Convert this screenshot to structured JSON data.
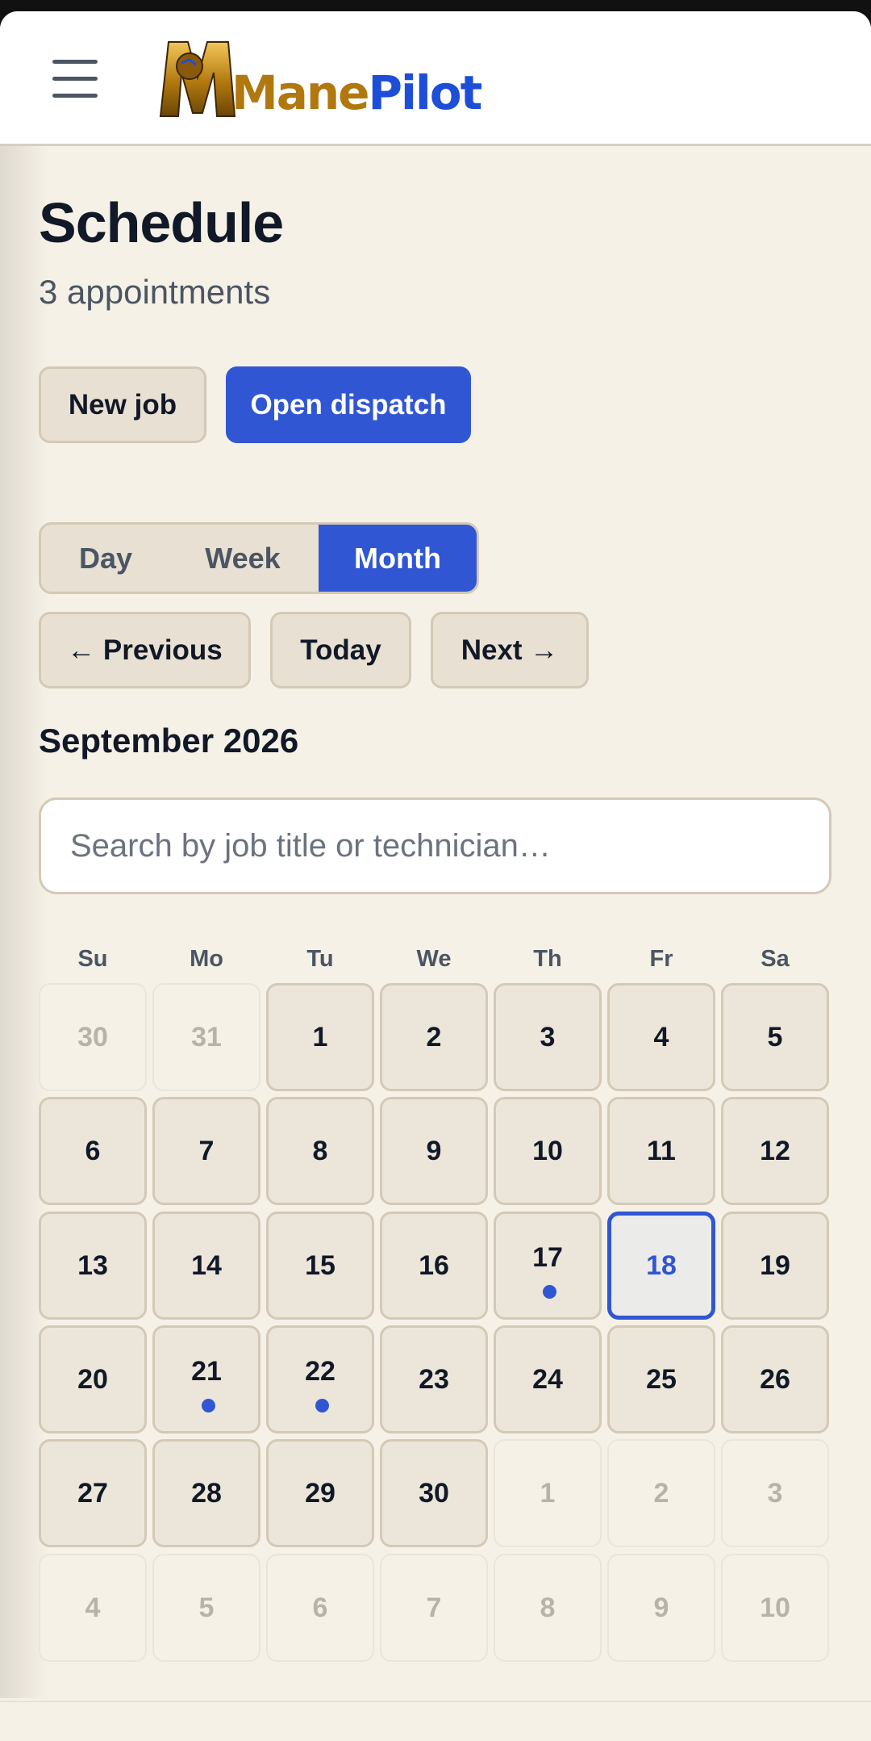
{
  "brand": {
    "name_part1": "Mane",
    "name_part2": "Pilot",
    "menu_icon": "hamburger-menu-icon",
    "logo_icon": "lion-logo-icon"
  },
  "page": {
    "title": "Schedule",
    "subtitle": "3 appointments"
  },
  "actions": {
    "new_job_label": "New job",
    "open_dispatch_label": "Open dispatch"
  },
  "view_toggle": {
    "options": [
      {
        "label": "Day",
        "active": false
      },
      {
        "label": "Week",
        "active": false
      },
      {
        "label": "Month",
        "active": true
      }
    ]
  },
  "nav": {
    "previous_label": "← Previous",
    "today_label": "Today",
    "next_label": "Next →"
  },
  "calendar": {
    "month_label": "September 2026",
    "search_placeholder": "Search by job title or technician…",
    "weekdays": [
      "Su",
      "Mo",
      "Tu",
      "We",
      "Th",
      "Fr",
      "Sa"
    ],
    "weeks": [
      [
        {
          "day": "30",
          "current": false
        },
        {
          "day": "31",
          "current": false
        },
        {
          "day": "1",
          "current": true
        },
        {
          "day": "2",
          "current": true
        },
        {
          "day": "3",
          "current": true
        },
        {
          "day": "4",
          "current": true
        },
        {
          "day": "5",
          "current": true
        }
      ],
      [
        {
          "day": "6",
          "current": true
        },
        {
          "day": "7",
          "current": true
        },
        {
          "day": "8",
          "current": true
        },
        {
          "day": "9",
          "current": true
        },
        {
          "day": "10",
          "current": true
        },
        {
          "day": "11",
          "current": true
        },
        {
          "day": "12",
          "current": true
        }
      ],
      [
        {
          "day": "13",
          "current": true
        },
        {
          "day": "14",
          "current": true
        },
        {
          "day": "15",
          "current": true
        },
        {
          "day": "16",
          "current": true
        },
        {
          "day": "17",
          "current": true,
          "event": true
        },
        {
          "day": "18",
          "current": true,
          "today": true
        },
        {
          "day": "19",
          "current": true
        }
      ],
      [
        {
          "day": "20",
          "current": true
        },
        {
          "day": "21",
          "current": true,
          "event": true
        },
        {
          "day": "22",
          "current": true,
          "event": true
        },
        {
          "day": "23",
          "current": true
        },
        {
          "day": "24",
          "current": true
        },
        {
          "day": "25",
          "current": true
        },
        {
          "day": "26",
          "current": true
        }
      ],
      [
        {
          "day": "27",
          "current": true
        },
        {
          "day": "28",
          "current": true
        },
        {
          "day": "29",
          "current": true
        },
        {
          "day": "30",
          "current": true
        },
        {
          "day": "1",
          "current": false
        },
        {
          "day": "2",
          "current": false
        },
        {
          "day": "3",
          "current": false
        }
      ],
      [
        {
          "day": "4",
          "current": false
        },
        {
          "day": "5",
          "current": false
        },
        {
          "day": "6",
          "current": false
        },
        {
          "day": "7",
          "current": false
        },
        {
          "day": "8",
          "current": false
        },
        {
          "day": "9",
          "current": false
        },
        {
          "day": "10",
          "current": false
        }
      ]
    ]
  },
  "colors": {
    "accent": "#3056d3",
    "background": "#f6f1e7",
    "cell": "#ece6da",
    "logo_gold": "#b0780e"
  }
}
